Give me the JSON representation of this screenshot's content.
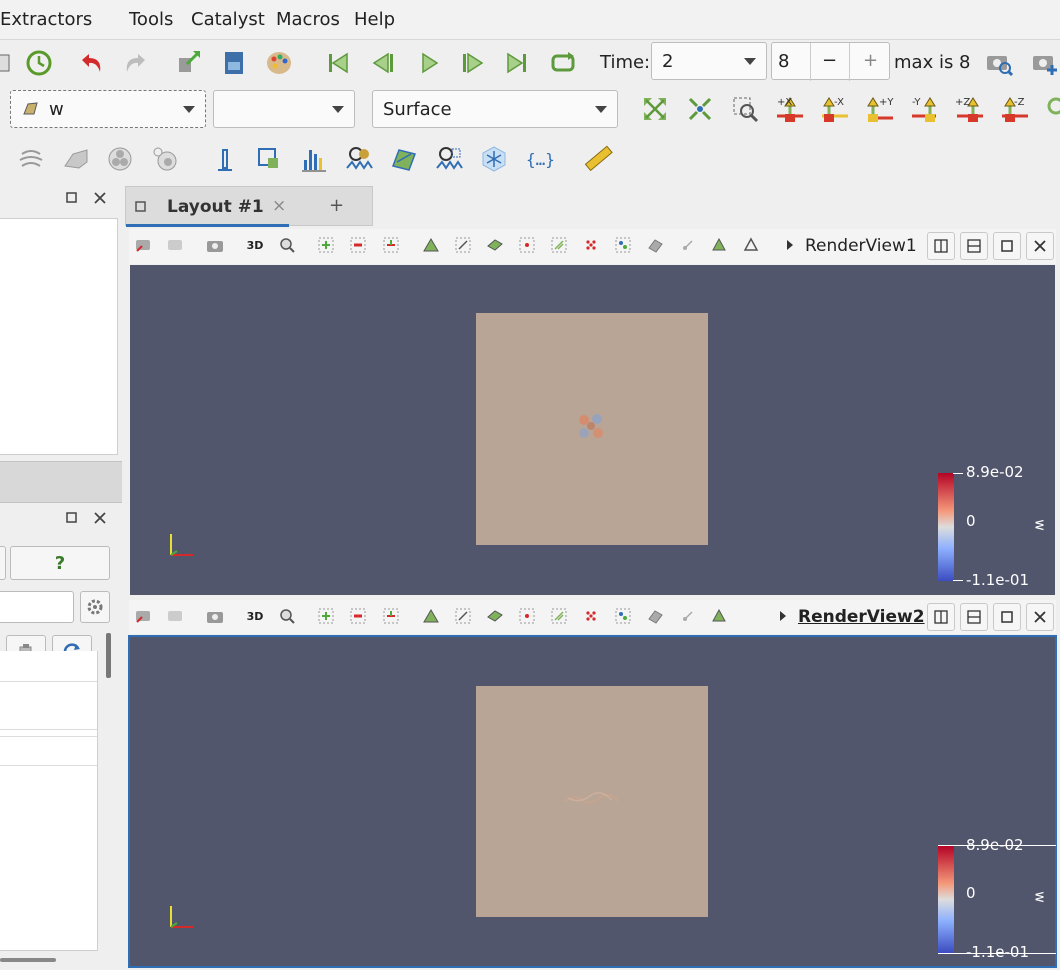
{
  "menu": [
    "Extractors",
    "Tools",
    "Catalyst",
    "Macros",
    "Help"
  ],
  "toolbar": {
    "time_label": "Time:",
    "time_value": "2",
    "step_value": "8",
    "minus": "−",
    "plus": "+",
    "max_text": "max is 8"
  },
  "selectors": {
    "variable": "w",
    "component": "",
    "representation": "Surface"
  },
  "camera_buttons": [
    "+X",
    "-X",
    "+Y",
    "-Y",
    "+Z",
    "-Z"
  ],
  "left_panel": {
    "help_button": "?"
  },
  "layout_tabs": {
    "active_tab": "Layout #1",
    "close": "×",
    "add": "+"
  },
  "views": [
    {
      "title": "RenderView1",
      "colorbar": {
        "max": "8.9e-02",
        "mid": "0",
        "min": "-1.1e-01",
        "variable": "w"
      }
    },
    {
      "title": "RenderView2",
      "colorbar": {
        "max": "8.9e-02",
        "mid": "0",
        "min": "-1.1e-01",
        "variable": "w"
      }
    }
  ],
  "colors": {
    "background": "#52566d",
    "surface": "#b9a596",
    "accent": "#2f6db5"
  }
}
